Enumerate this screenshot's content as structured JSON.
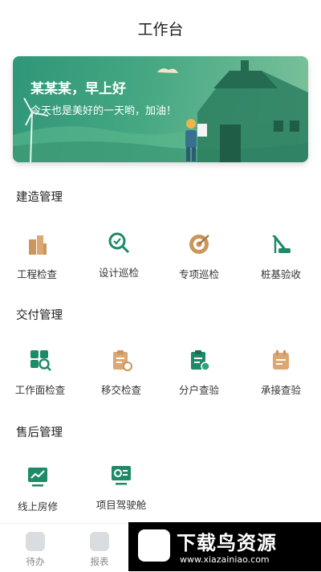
{
  "header": {
    "title": "工作台"
  },
  "banner": {
    "greeting": "某某某，早上好",
    "subtitle": "今天也是美好的一天哟，加油！"
  },
  "sections": [
    {
      "title": "建造管理",
      "items": [
        {
          "label": "工程检查",
          "icon": "building-icon",
          "color": "#c9965b"
        },
        {
          "label": "设计巡检",
          "icon": "magnifier-check-icon",
          "color": "#1e8a67"
        },
        {
          "label": "专项巡检",
          "icon": "target-icon",
          "color": "#c9965b"
        },
        {
          "label": "桩基验收",
          "icon": "pile-driver-icon",
          "color": "#1e8a67"
        }
      ]
    },
    {
      "title": "交付管理",
      "items": [
        {
          "label": "工作面检查",
          "icon": "grid-search-icon",
          "color": "#1e8a67"
        },
        {
          "label": "移交检查",
          "icon": "clipboard-transfer-icon",
          "color": "#c9965b"
        },
        {
          "label": "分户查验",
          "icon": "clipboard-check-icon",
          "color": "#1e8a67"
        },
        {
          "label": "承接查验",
          "icon": "calendar-check-icon",
          "color": "#c9965b"
        }
      ]
    },
    {
      "title": "售后管理",
      "items": [
        {
          "label": "线上房修",
          "icon": "monitor-chart-icon",
          "color": "#1e8a67"
        },
        {
          "label": "项目驾驶舱",
          "icon": "dashboard-screen-icon",
          "color": "#1e8a67"
        }
      ]
    }
  ],
  "tabbar": {
    "tabs": [
      {
        "label": "待办",
        "icon": "todo-icon"
      },
      {
        "label": "报表",
        "icon": "report-icon"
      }
    ]
  },
  "watermark": {
    "title": "下载鸟资源",
    "url": "www.xiazainiao.com"
  }
}
